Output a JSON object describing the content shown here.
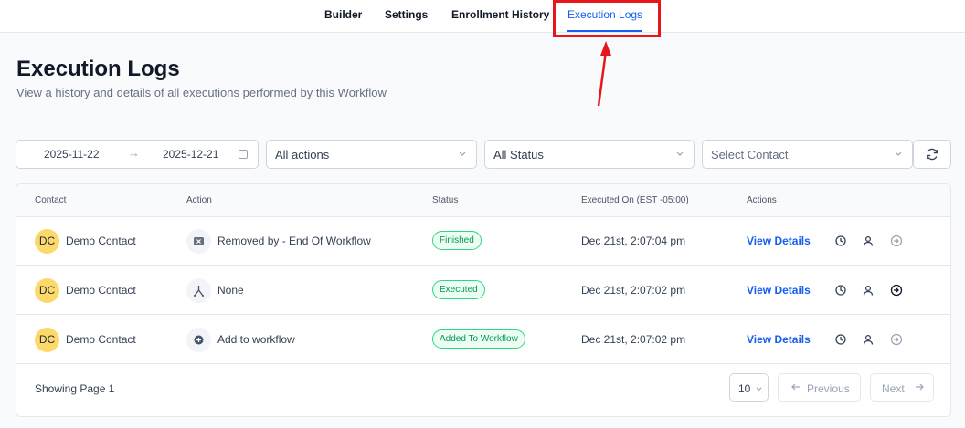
{
  "tabs": [
    "Builder",
    "Settings",
    "Enrollment History",
    "Execution Logs"
  ],
  "active_tab": "Execution Logs",
  "colors": {
    "accent": "#155eef",
    "highlight": "#e8151b",
    "badge_green": "#039855",
    "avatar": "#fdd96a"
  },
  "page": {
    "title": "Execution Logs",
    "subtitle": "View a history and details of all executions performed by this Workflow"
  },
  "filters": {
    "date_start": "2025-11-22",
    "date_end": "2025-12-21",
    "actions_value": "All actions",
    "status_value": "All Status",
    "contact_placeholder": "Select Contact"
  },
  "table": {
    "columns": [
      "Contact",
      "Action",
      "Status",
      "Executed On (EST -05:00)",
      "Actions"
    ],
    "rows": [
      {
        "avatar": "DC",
        "contact": "Demo Contact",
        "action_icon": "remove-icon",
        "action": "Removed by - End Of Workflow",
        "status": "Finished",
        "executed_on": "Dec 21st, 2:07:04 pm",
        "view": "View Details"
      },
      {
        "avatar": "DC",
        "contact": "Demo Contact",
        "action_icon": "branch-icon",
        "action": "None",
        "status": "Executed",
        "executed_on": "Dec 21st, 2:07:02 pm",
        "view": "View Details"
      },
      {
        "avatar": "DC",
        "contact": "Demo Contact",
        "action_icon": "add-circle-icon",
        "action": "Add to workflow",
        "status": "Added To Workflow",
        "executed_on": "Dec 21st, 2:07:02 pm",
        "view": "View Details"
      }
    ]
  },
  "footer": {
    "showing": "Showing Page 1",
    "per_page": "10",
    "previous": "Previous",
    "next": "Next"
  }
}
